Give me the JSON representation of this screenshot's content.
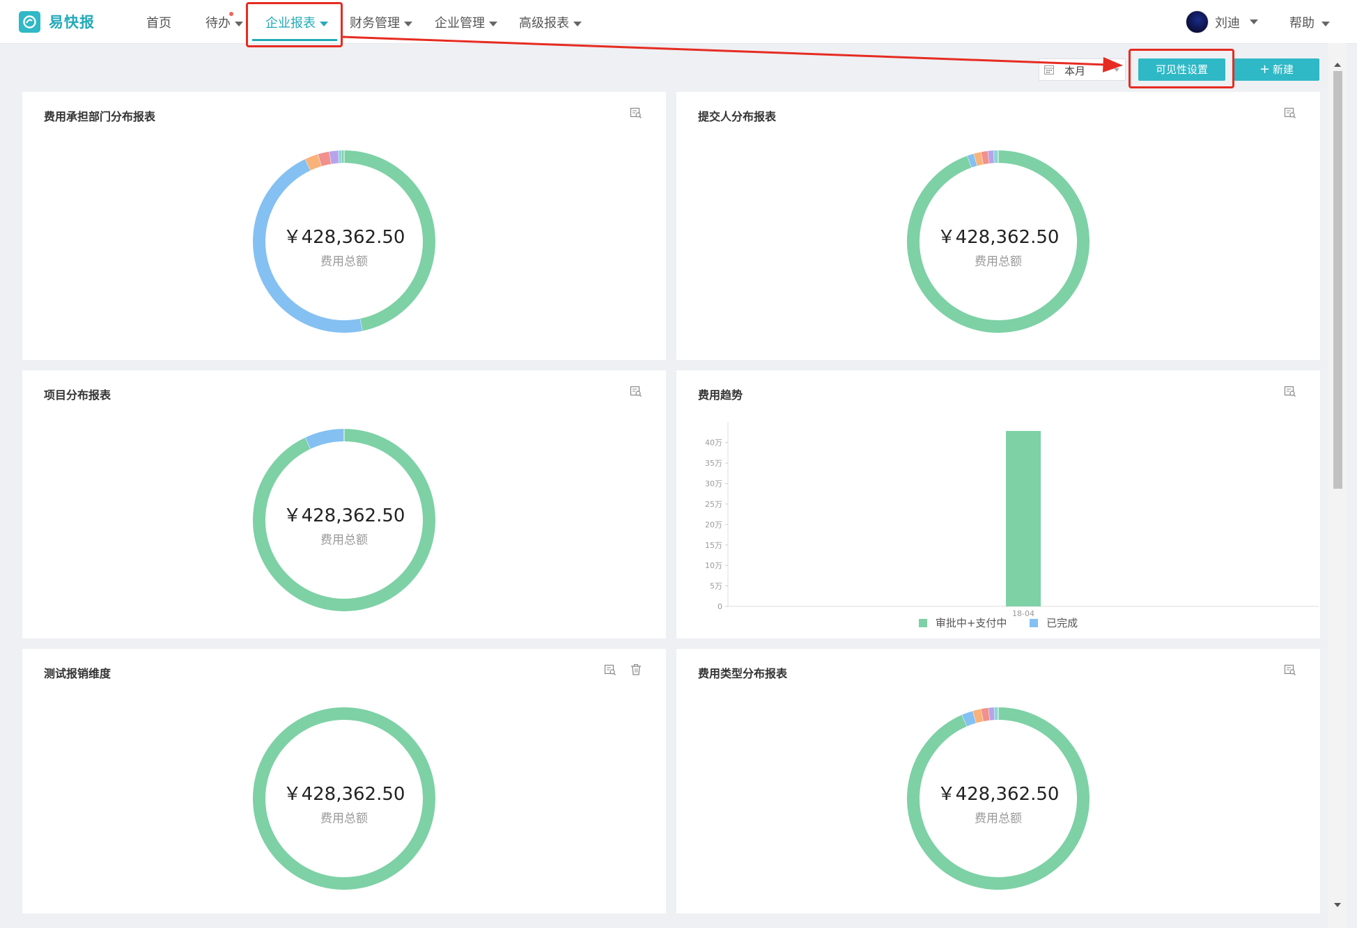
{
  "app": {
    "name": "易快报"
  },
  "nav": {
    "items": [
      {
        "label": "首页",
        "has_caret": false
      },
      {
        "label": "待办",
        "has_caret": true,
        "has_dot": true
      },
      {
        "label": "企业报表",
        "has_caret": true,
        "active": true
      },
      {
        "label": "财务管理",
        "has_caret": true
      },
      {
        "label": "企业管理",
        "has_caret": true
      },
      {
        "label": "高级报表",
        "has_caret": true
      }
    ]
  },
  "user": {
    "name": "刘迪"
  },
  "help": {
    "label": "帮助"
  },
  "toolbar": {
    "date_range": "本月",
    "visibility_button": "可见性设置",
    "new_button": "新建"
  },
  "colors": {
    "accent": "#2fb8c6",
    "green": "#7dd1a5",
    "blue": "#84c0f2",
    "orange": "#f8b27a",
    "red": "#f1908c",
    "purple": "#b7a3ea",
    "teal": "#8fd4d8",
    "annotation": "#e62b21"
  },
  "cards": [
    {
      "title": "费用承担部门分布报表",
      "amount": "￥428,362.50",
      "amount_label": "费用总额",
      "slices": [
        {
          "value": 0.468,
          "color": "#7dd1a5"
        },
        {
          "value": 0.462,
          "color": "#84c0f2"
        },
        {
          "value": 0.024,
          "color": "#f8b27a"
        },
        {
          "value": 0.02,
          "color": "#f1908c"
        },
        {
          "value": 0.016,
          "color": "#b7a3ea"
        },
        {
          "value": 0.006,
          "color": "#8fd4d8"
        },
        {
          "value": 0.004,
          "color": "#7dd1a5"
        }
      ]
    },
    {
      "title": "提交人分布报表",
      "amount": "￥428,362.50",
      "amount_label": "费用总额",
      "slices": [
        {
          "value": 0.945,
          "color": "#7dd1a5"
        },
        {
          "value": 0.012,
          "color": "#84c0f2"
        },
        {
          "value": 0.013,
          "color": "#f8b27a"
        },
        {
          "value": 0.012,
          "color": "#f1908c"
        },
        {
          "value": 0.01,
          "color": "#b7a3ea"
        },
        {
          "value": 0.008,
          "color": "#8fd4d8"
        }
      ]
    },
    {
      "title": "项目分布报表",
      "amount": "￥428,362.50",
      "amount_label": "费用总额",
      "slices": [
        {
          "value": 0.93,
          "color": "#7dd1a5"
        },
        {
          "value": 0.07,
          "color": "#84c0f2"
        }
      ]
    },
    {
      "title": "费用趋势"
    },
    {
      "title": "测试报销维度",
      "amount": "￥428,362.50",
      "amount_label": "费用总额",
      "slices": [
        {
          "value": 1,
          "color": "#7dd1a5"
        }
      ]
    },
    {
      "title": "费用类型分布报表",
      "amount": "￥428,362.50",
      "amount_label": "费用总额",
      "slices": [
        {
          "value": 0.935,
          "color": "#7dd1a5"
        },
        {
          "value": 0.02,
          "color": "#84c0f2"
        },
        {
          "value": 0.015,
          "color": "#f8b27a"
        },
        {
          "value": 0.013,
          "color": "#f1908c"
        },
        {
          "value": 0.01,
          "color": "#b7a3ea"
        },
        {
          "value": 0.007,
          "color": "#8fd4d8"
        }
      ]
    }
  ],
  "chart_data": {
    "type": "bar",
    "title": "费用趋势",
    "categories": [
      "18-04"
    ],
    "series": [
      {
        "name": "审批中+支付中",
        "values": [
          428362.5
        ],
        "color": "#7dd1a5"
      },
      {
        "name": "已完成",
        "values": [
          0
        ],
        "color": "#84c0f2"
      }
    ],
    "y_ticks": [
      "0",
      "5万",
      "10万",
      "15万",
      "20万",
      "25万",
      "30万",
      "35万",
      "40万"
    ],
    "ylim": [
      0,
      425000
    ],
    "legend_position": "bottom-center"
  }
}
